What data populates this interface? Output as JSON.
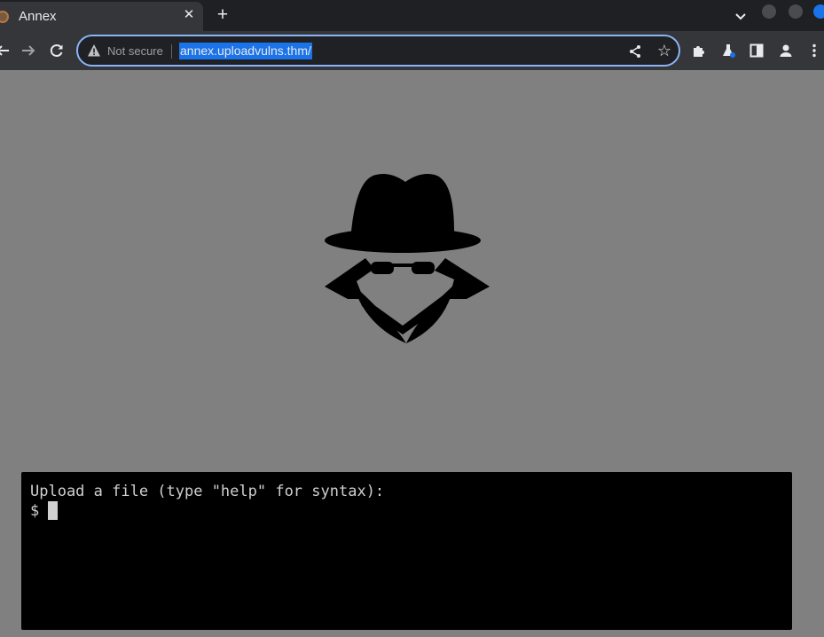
{
  "browser": {
    "tab": {
      "title": "Annex",
      "close_glyph": "✕"
    },
    "new_tab_glyph": "+",
    "address_bar": {
      "security_label": "Not secure",
      "url": "annex.uploadvulns.thm/"
    },
    "star_glyph": "☆"
  },
  "terminal": {
    "prompt_line": "Upload a file (type \"help\" for syntax):",
    "prompt_symbol": "$"
  },
  "colors": {
    "page_background": "#808080",
    "terminal_background": "#000000",
    "url_highlight": "#1a73e8",
    "omnibox_focus_ring": "#8ab4f8"
  },
  "icons": {
    "page_graphic": "spy-icon"
  }
}
